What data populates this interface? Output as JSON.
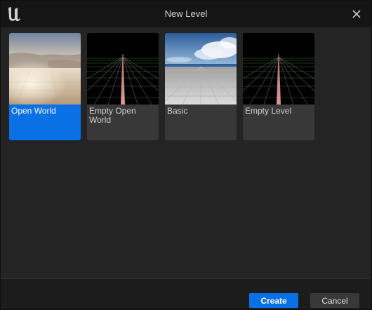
{
  "window": {
    "title": "New Level"
  },
  "icons": {
    "logo": "unreal-engine-logo-icon",
    "close": "close-icon"
  },
  "templates": [
    {
      "label": "Open World",
      "selected": true,
      "thumbnail": "desert-landscape"
    },
    {
      "label": "Empty Open World",
      "selected": false,
      "thumbnail": "grid-horizon"
    },
    {
      "label": "Basic",
      "selected": false,
      "thumbnail": "sky-checker-floor"
    },
    {
      "label": "Empty Level",
      "selected": false,
      "thumbnail": "grid-horizon"
    }
  ],
  "footer": {
    "create_label": "Create",
    "cancel_label": "Cancel"
  },
  "colors": {
    "accent": "#0a70e6",
    "card": "#383838",
    "background": "#242424",
    "titlebar": "#151515"
  }
}
